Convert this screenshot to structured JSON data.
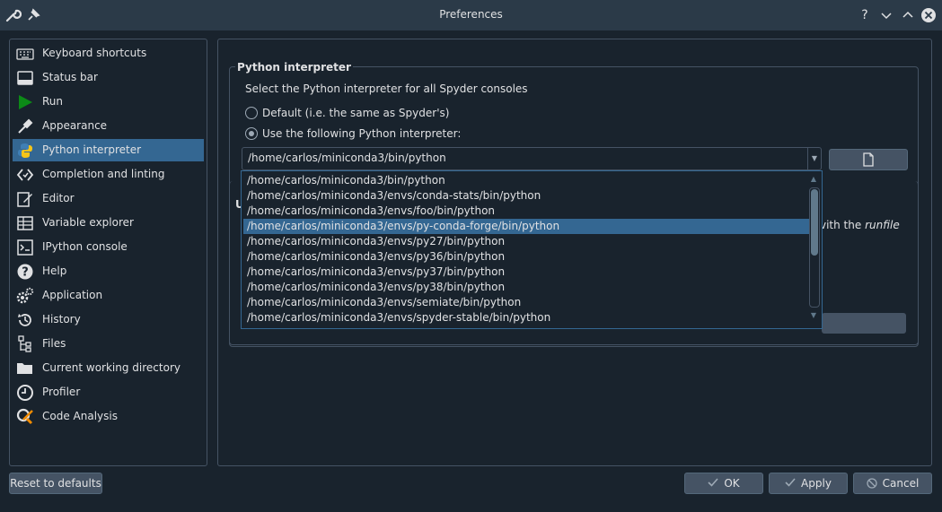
{
  "window": {
    "title": "Preferences",
    "help_label": "?"
  },
  "sidebar": {
    "items": [
      {
        "label": "Keyboard shortcuts",
        "icon": "keyboard-icon"
      },
      {
        "label": "Status bar",
        "icon": "status-bar-icon"
      },
      {
        "label": "Run",
        "icon": "run-icon"
      },
      {
        "label": "Appearance",
        "icon": "eyedropper-icon"
      },
      {
        "label": "Python interpreter",
        "icon": "python-icon",
        "selected": true
      },
      {
        "label": "Completion and linting",
        "icon": "completion-icon"
      },
      {
        "label": "Editor",
        "icon": "editor-icon"
      },
      {
        "label": "Variable explorer",
        "icon": "variable-explorer-icon"
      },
      {
        "label": "IPython console",
        "icon": "ipython-console-icon"
      },
      {
        "label": "Help",
        "icon": "help-icon"
      },
      {
        "label": "Application",
        "icon": "gears-icon"
      },
      {
        "label": "History",
        "icon": "history-icon"
      },
      {
        "label": "Files",
        "icon": "files-icon"
      },
      {
        "label": "Current working directory",
        "icon": "folder-icon"
      },
      {
        "label": "Profiler",
        "icon": "profiler-icon"
      },
      {
        "label": "Code Analysis",
        "icon": "code-analysis-icon"
      }
    ]
  },
  "interpreter": {
    "group_title": "Python interpreter",
    "description": "Select the Python interpreter for all Spyder consoles",
    "option_default": "Default (i.e. the same as Spyder's)",
    "option_custom": "Use the following Python interpreter:",
    "selected_path": "/home/carlos/miniconda3/bin/python",
    "options": [
      "/home/carlos/miniconda3/bin/python",
      "/home/carlos/miniconda3/envs/conda-stats/bin/python",
      "/home/carlos/miniconda3/envs/foo/bin/python",
      "/home/carlos/miniconda3/envs/py-conda-forge/bin/python",
      "/home/carlos/miniconda3/envs/py27/bin/python",
      "/home/carlos/miniconda3/envs/py36/bin/python",
      "/home/carlos/miniconda3/envs/py37/bin/python",
      "/home/carlos/miniconda3/envs/py38/bin/python",
      "/home/carlos/miniconda3/envs/semiate/bin/python",
      "/home/carlos/miniconda3/envs/spyder-stable/bin/python"
    ],
    "highlighted_index": 3
  },
  "hidden_group": {
    "title_fragment": "U",
    "text_fragment": "vith the",
    "italic_word": "runfile"
  },
  "buttons": {
    "reset": "Reset to defaults",
    "ok": "OK",
    "apply": "Apply",
    "cancel": "Cancel"
  },
  "colors": {
    "background": "#19232d",
    "selection": "#346792",
    "border": "#455364",
    "button": "#455364"
  }
}
